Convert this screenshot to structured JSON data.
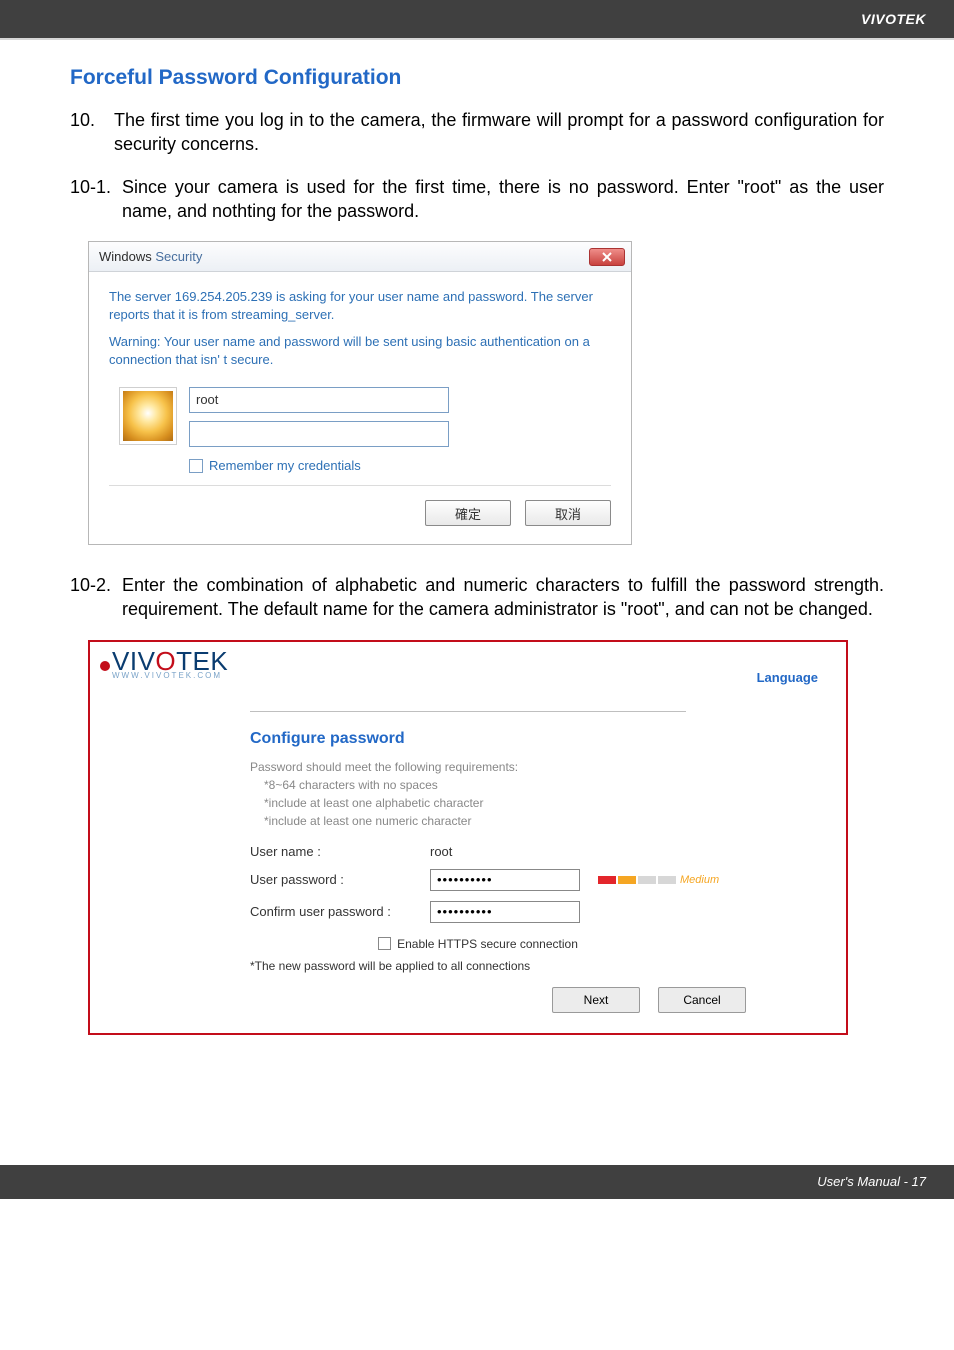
{
  "header": {
    "brand": "VIVOTEK"
  },
  "title": "Forceful Password Configuration",
  "para10": {
    "num": "10.",
    "text": "The first time you log in to the camera, the firmware will prompt for a password configuration for security concerns."
  },
  "para10_1": {
    "num": "10-1.",
    "text": "Since your camera is used for the first time, there is no password. Enter \"root\" as the user name, and nothting for the password."
  },
  "winDialog": {
    "titleA": "Windows ",
    "titleB": "Security",
    "line1": "The server 169.254.205.239 is asking for your user name and password. The server reports that it is from streaming_server.",
    "line2": "Warning: Your user name and password will be sent using basic authentication on a connection that isn' t secure.",
    "userValue": "root",
    "remember": "Remember my credentials",
    "ok": "確定",
    "cancel": "取消"
  },
  "para10_2": {
    "num": "10-2.",
    "text": "Enter the combination of alphabetic and numeric characters to fulfill the password strength. requirement. The default name for the camera administrator is \"root\", and can not be changed."
  },
  "vvt": {
    "logoPrefix": "VIV",
    "logoAccent": "O",
    "logoSuffix": "TEK",
    "logoSub": "WWW.VIVOTEK.COM",
    "language": "Language",
    "heading": "Configure password",
    "req0": "Password should meet the following requirements:",
    "req1": "*8~64 characters with no spaces",
    "req2": "*include at least one alphabetic character",
    "req3": "*include at least one numeric character",
    "userLabel": "User name :",
    "userValue": "root",
    "passLabel": "User password :",
    "passValue": "••••••••••",
    "confirmLabel": "Confirm user password :",
    "confirmValue": "••••••••••",
    "strength": "Medium",
    "https": "Enable HTTPS secure connection",
    "note": "*The new password will be applied to all connections",
    "next": "Next",
    "cancel": "Cancel"
  },
  "footer": {
    "text": "User's Manual - 17"
  }
}
